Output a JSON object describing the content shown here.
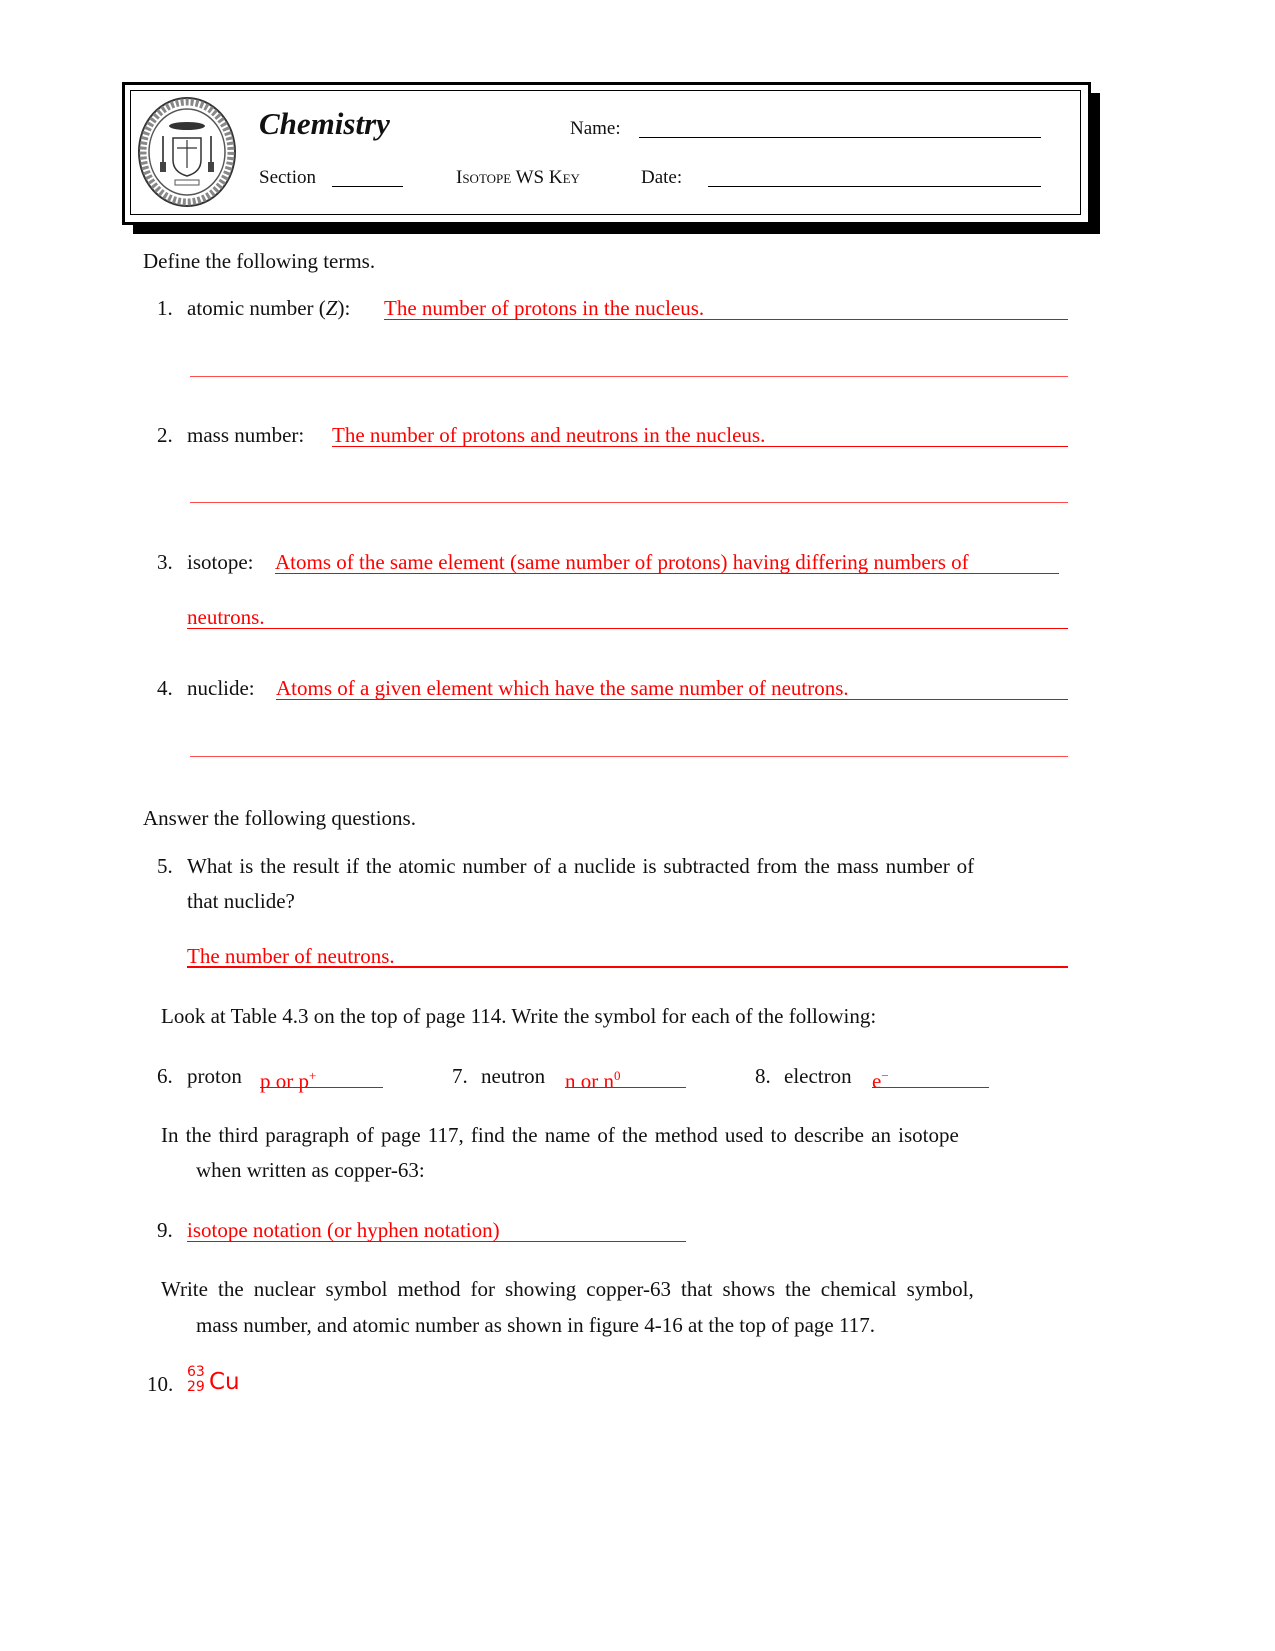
{
  "header": {
    "course_title": "Chemistry",
    "name_label": "Name:",
    "section_label": "Section",
    "worksheet_title": "Isotope WS Key",
    "date_label": "Date:",
    "logo": {
      "icon": "school-seal-icon",
      "text_top": "BISHOP LUDDEN",
      "text_bottom": "JUNIOR SENIOR HIGH SCHOOL",
      "est": "EST. 1961"
    }
  },
  "part1": {
    "instruction": "Define the following terms.",
    "items": [
      {
        "number": "1.",
        "term_pre": "atomic number (",
        "term_italic": "Z",
        "term_post": "):",
        "answer": "The number of protons in the nucleus.",
        "answer_cont": ""
      },
      {
        "number": "2.",
        "term": "mass number:",
        "answer": "The number of protons and neutrons in the nucleus.",
        "answer_cont": ""
      },
      {
        "number": "3.",
        "term": "isotope:",
        "answer": "Atoms of the same element (same number of protons) having differing numbers of",
        "answer_cont": "neutrons."
      },
      {
        "number": "4.",
        "term": "nuclide:",
        "answer": "Atoms of a given element which have the same number of neutrons.",
        "answer_cont": ""
      }
    ]
  },
  "part2": {
    "instruction": "Answer the following questions.",
    "q5": {
      "number": "5.",
      "line1": "What is the result if the atomic number of a nuclide is subtracted from the mass number of",
      "line2": "that nuclide?",
      "answer": "The number of neutrons."
    },
    "table_instruction": "Look at Table 4.3 on the top of page 114.  Write the symbol for each of the following:",
    "symbols": [
      {
        "number": "6.",
        "label": "proton",
        "answer": "p or p",
        "sup": "+"
      },
      {
        "number": "7.",
        "label": "neutron",
        "answer": "n or n",
        "sup": "0"
      },
      {
        "number": "8.",
        "label": "electron",
        "answer": "e",
        "sup": "−"
      }
    ],
    "q9_instruction_line1": "In the third paragraph of page 117, find the name of the method used to describe an isotope",
    "q9_instruction_line2": "when written as copper-63:",
    "q9": {
      "number": "9.",
      "answer": "isotope notation (or hyphen notation)"
    },
    "q10_instruction_line1": "Write the nuclear symbol method for showing copper-63 that shows the chemical symbol,",
    "q10_instruction_line2": "mass number, and atomic number as shown in figure 4-16 at the top of page 117.",
    "q10": {
      "number": "10.",
      "mass_number": "63",
      "atomic_number": "29",
      "symbol": "Cu"
    }
  },
  "colors": {
    "answer": "#ff0000",
    "text": "#111111"
  }
}
